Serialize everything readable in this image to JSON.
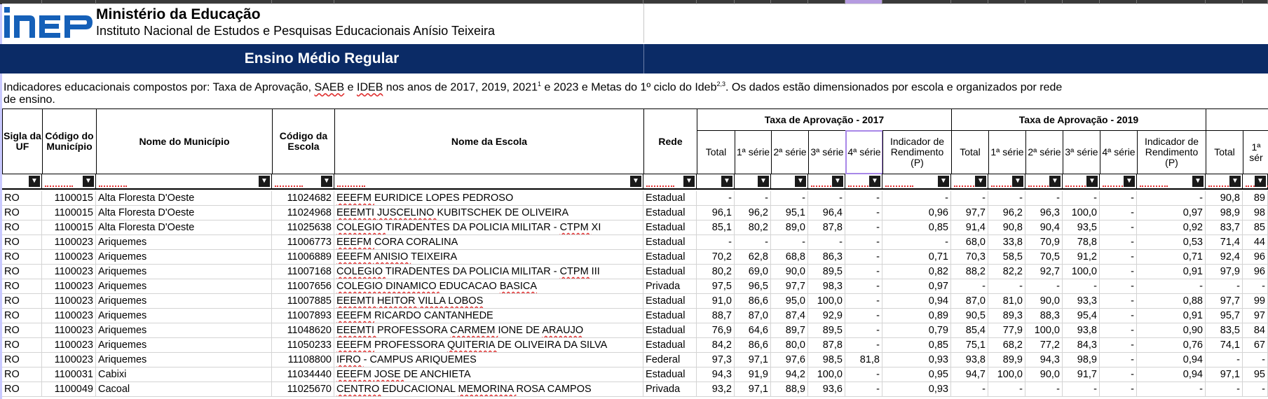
{
  "header": {
    "ministry": "Ministério da Educação",
    "institute": "Instituto Nacional de Estudos e Pesquisas Educacionais Anísio Teixeira",
    "logo_text": "inep"
  },
  "banner": {
    "title": "Ensino Médio Regular"
  },
  "description": {
    "line1_a": "Indicadores educacionais compostos por: Taxa de Aprovação, ",
    "saeb": "SAEB",
    "e": " e ",
    "ideb": "IDEB",
    "line1_b": " nos anos de 2017, 2019, 2021",
    "sup1": "1",
    "line1_c": " e 2023 e Metas do 1º ciclo do Ideb",
    "sup2": "2,3",
    "line1_d": ". Os dados estão dimensionados por escola e organizados por rede",
    "line2": "de ensino."
  },
  "columns": {
    "sigla": "Sigla da UF",
    "codmun": "Código do Município",
    "nomemun": "Nome do Município",
    "codesc": "Código da Escola",
    "nomeesc": "Nome da Escola",
    "rede": "Rede",
    "group2017": "Taxa de Aprovação - 2017",
    "group2019": "Taxa de Aprovação - 2019",
    "total": "Total",
    "s1": "1ª série",
    "s2": "2ª série",
    "s3": "3ª série",
    "s4": "4ª série",
    "indicador": "Indicador de Rendimento (P)",
    "s1_cut": "1ª sér"
  },
  "filter_icon": "dropdown-arrow-icon",
  "rows": [
    [
      "RO",
      "1100015",
      "Alta Floresta D'Oeste",
      "11024682",
      "EEEFM EURIDICE LOPES PEDROSO",
      "Estadual",
      "-",
      "-",
      "-",
      "-",
      "-",
      "-",
      "-",
      "-",
      "-",
      "-",
      "-",
      "-",
      "90,8",
      "89"
    ],
    [
      "RO",
      "1100015",
      "Alta Floresta D'Oeste",
      "11024968",
      "EEEMTI JUSCELINO KUBITSCHEK DE OLIVEIRA",
      "Estadual",
      "96,1",
      "96,2",
      "95,1",
      "96,4",
      "-",
      "0,96",
      "97,7",
      "96,2",
      "96,3",
      "100,0",
      "-",
      "0,97",
      "98,9",
      "98"
    ],
    [
      "RO",
      "1100015",
      "Alta Floresta D'Oeste",
      "11025638",
      "COLEGIO TIRADENTES DA POLICIA MILITAR - CTPM XI",
      "Estadual",
      "85,1",
      "80,2",
      "89,0",
      "87,8",
      "-",
      "0,85",
      "91,4",
      "90,8",
      "90,4",
      "93,5",
      "-",
      "0,92",
      "83,7",
      "85"
    ],
    [
      "RO",
      "1100023",
      "Ariquemes",
      "11006773",
      "EEEFM CORA CORALINA",
      "Estadual",
      "-",
      "-",
      "-",
      "-",
      "-",
      "-",
      "68,0",
      "33,8",
      "70,9",
      "78,8",
      "-",
      "0,53",
      "71,4",
      "44"
    ],
    [
      "RO",
      "1100023",
      "Ariquemes",
      "11006889",
      "EEEFM ANISIO TEIXEIRA",
      "Estadual",
      "70,2",
      "62,8",
      "68,8",
      "86,3",
      "-",
      "0,71",
      "70,3",
      "58,5",
      "70,5",
      "91,2",
      "-",
      "0,71",
      "92,4",
      "96"
    ],
    [
      "RO",
      "1100023",
      "Ariquemes",
      "11007168",
      "COLEGIO TIRADENTES DA POLICIA MILITAR - CTPM III",
      "Estadual",
      "80,2",
      "69,0",
      "90,0",
      "89,5",
      "-",
      "0,82",
      "88,2",
      "82,2",
      "92,7",
      "100,0",
      "-",
      "0,91",
      "97,9",
      "96"
    ],
    [
      "RO",
      "1100023",
      "Ariquemes",
      "11007656",
      "COLEGIO DINAMICO EDUCACAO BASICA",
      "Privada",
      "97,5",
      "96,5",
      "97,7",
      "98,3",
      "-",
      "0,97",
      "-",
      "-",
      "-",
      "-",
      "-",
      "-",
      "-",
      "-"
    ],
    [
      "RO",
      "1100023",
      "Ariquemes",
      "11007885",
      "EEEMTI HEITOR VILLA LOBOS",
      "Estadual",
      "91,0",
      "86,6",
      "95,0",
      "100,0",
      "-",
      "0,94",
      "87,0",
      "81,0",
      "90,0",
      "93,3",
      "-",
      "0,88",
      "97,7",
      "99"
    ],
    [
      "RO",
      "1100023",
      "Ariquemes",
      "11007893",
      "EEEFM RICARDO CANTANHEDE",
      "Estadual",
      "88,7",
      "87,0",
      "87,4",
      "92,9",
      "-",
      "0,89",
      "90,5",
      "89,3",
      "88,3",
      "95,4",
      "-",
      "0,91",
      "95,7",
      "97"
    ],
    [
      "RO",
      "1100023",
      "Ariquemes",
      "11048620",
      "EEEMTI PROFESSORA CARMEM IONE DE ARAUJO",
      "Estadual",
      "76,9",
      "64,6",
      "89,7",
      "89,5",
      "-",
      "0,79",
      "85,4",
      "77,9",
      "100,0",
      "93,8",
      "-",
      "0,90",
      "83,5",
      "84"
    ],
    [
      "RO",
      "1100023",
      "Ariquemes",
      "11050233",
      "EEEFM PROFESSORA QUITERIA DE OLIVEIRA DA SILVA",
      "Estadual",
      "84,2",
      "86,6",
      "80,0",
      "87,8",
      "-",
      "0,85",
      "75,1",
      "68,2",
      "77,2",
      "84,3",
      "-",
      "0,76",
      "74,1",
      "67"
    ],
    [
      "RO",
      "1100023",
      "Ariquemes",
      "11108800",
      "IFRO - CAMPUS ARIQUEMES",
      "Federal",
      "97,3",
      "97,1",
      "97,6",
      "98,5",
      "81,8",
      "0,93",
      "93,8",
      "89,9",
      "94,3",
      "98,9",
      "-",
      "0,94",
      "-",
      "-"
    ],
    [
      "RO",
      "1100031",
      "Cabixi",
      "11034440",
      "EEEFM JOSE DE ANCHIETA",
      "Estadual",
      "94,3",
      "91,9",
      "94,2",
      "100,0",
      "-",
      "0,95",
      "94,7",
      "100,0",
      "90,0",
      "91,7",
      "-",
      "0,94",
      "97,1",
      "95"
    ],
    [
      "RO",
      "1100049",
      "Cacoal",
      "11025670",
      "CENTRO EDUCACIONAL MEMORINA ROSA CAMPOS",
      "Privada",
      "93,2",
      "97,1",
      "88,9",
      "93,6",
      "-",
      "0,93",
      "-",
      "-",
      "-",
      "-",
      "-",
      "-",
      "-",
      "-"
    ]
  ]
}
